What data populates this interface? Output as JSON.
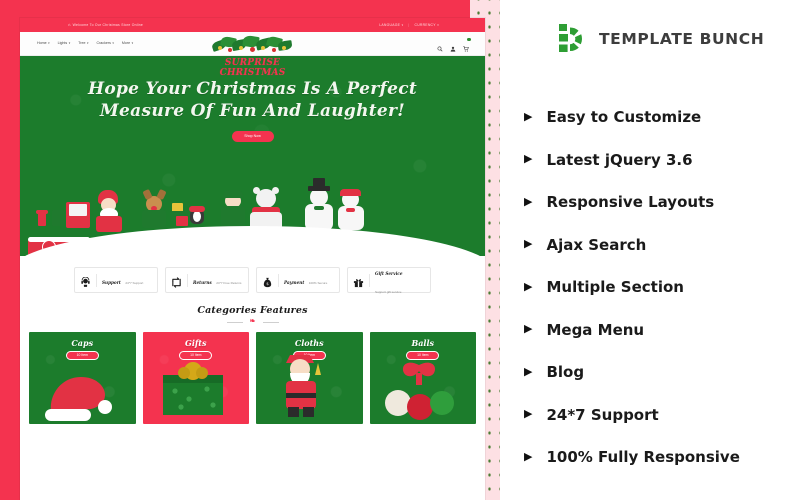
{
  "brand": {
    "name": "TEMPLATE BUNCH",
    "logo_icon": "template-bunch-logo",
    "accent": "#2e9e34",
    "frame_color": "#f4334f"
  },
  "features": [
    {
      "label": "Easy to Customize",
      "bullet": "▶"
    },
    {
      "label": "Latest jQuery 3.6",
      "bullet": "▶"
    },
    {
      "label": "Responsive Layouts",
      "bullet": "▶"
    },
    {
      "label": "Ajax Search",
      "bullet": "▶"
    },
    {
      "label": "Multiple Section",
      "bullet": "▶"
    },
    {
      "label": "Mega Menu",
      "bullet": "▶"
    },
    {
      "label": "Blog",
      "bullet": "▶"
    },
    {
      "label": "24*7 Support",
      "bullet": "▶"
    },
    {
      "label": "100% Fully Responsive",
      "bullet": "▶"
    }
  ],
  "preview": {
    "topbar": {
      "home_icon": "home-icon",
      "welcome": "Welcome To Our Christmas Store Online",
      "language": "LANGUAGE",
      "currency": "CURRENCY",
      "caret": "▾",
      "separator": "|"
    },
    "logo": {
      "line1": "SURPRISE",
      "line2": "CHRISTMAS"
    },
    "nav": {
      "items": [
        {
          "label": "Home",
          "caret": "▾"
        },
        {
          "label": "Lights",
          "caret": "▾"
        },
        {
          "label": "Tree",
          "caret": "▾"
        },
        {
          "label": "Crackers",
          "caret": "▾"
        },
        {
          "label": "More",
          "caret": "▾"
        }
      ],
      "icons": [
        "search-icon",
        "user-icon",
        "cart-icon"
      ]
    },
    "hero": {
      "line1": "Hope Your Christmas Is A Perfect",
      "line2": "Measure Of Fun And Laughter!",
      "cta": "Shop Now"
    },
    "services": [
      {
        "icon": "headset-icon",
        "title": "Support",
        "subtitle": "24*7 Support"
      },
      {
        "icon": "returns-icon",
        "title": "Returns",
        "subtitle": "24*7 Free Returns"
      },
      {
        "icon": "moneybag-icon",
        "title": "Payment",
        "subtitle": "100% Secure"
      },
      {
        "icon": "gift-icon",
        "title": "Gift Service",
        "subtitle": "Support gift service"
      }
    ],
    "categories_heading": "Categories Features",
    "categories": [
      {
        "name": "Caps",
        "badge": "10 Item",
        "color": "green",
        "product": "santa-hat"
      },
      {
        "name": "Gifts",
        "badge": "10 Item",
        "color": "red",
        "product": "gift-box"
      },
      {
        "name": "Cloths",
        "badge": "10 Item",
        "color": "green",
        "product": "santa-figure"
      },
      {
        "name": "Balls",
        "badge": "10 Item",
        "color": "green",
        "product": "ornament-balls"
      }
    ]
  }
}
